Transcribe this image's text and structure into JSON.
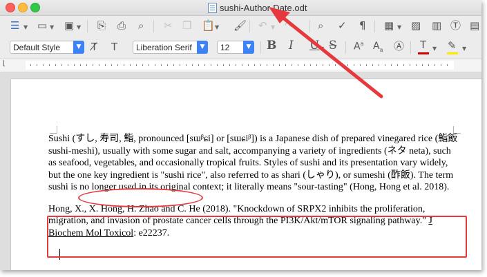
{
  "window": {
    "title": "sushi-Author-Date.odt"
  },
  "toolbar": {
    "paragraph_style": "Default Style",
    "font_name": "Liberation Serif",
    "font_size": "12",
    "bold_label": "B",
    "italic_label": "I",
    "underline_label": "U",
    "strike_label": "S",
    "font_color": "#cc0000",
    "highlight_color": "#ffe600",
    "icons": [
      "sidebar-icon",
      "open-folder-icon",
      "save-icon",
      "export-pdf-icon",
      "print-icon",
      "print-preview-icon",
      "cut-icon",
      "copy-icon",
      "paste-icon",
      "clone-formatting-icon",
      "undo-icon",
      "redo-icon",
      "find-replace-icon",
      "spelling-icon",
      "formatting-marks-icon",
      "insert-table-icon",
      "insert-image-icon",
      "insert-chart-icon",
      "insert-textbox-icon",
      "clear-formatting-icon",
      "style-update-icon",
      "superscript-icon",
      "subscript-icon"
    ]
  },
  "document": {
    "paragraph1": "Sushi (すし, 寿司, 鮨, pronounced [sɯᵝɕi] or [sɯɕiᵝ]) is a Japanese dish of prepared vinegared rice (鮨飯 sushi-meshi), usually with some sugar and salt, accompanying a variety of ingredients (ネタ neta), such as seafood, vegetables, and occasionally tropical fruits. Styles of sushi and its presentation vary widely, but the one key ingredient is \"sushi rice\", also referred to as shari (しゃり), or sumeshi (酢飯). The term sushi is no longer used in its original context; it literally means \"sour-tasting\"",
    "citation": " (Hong, Hong et al. 2018).",
    "reference_main": "Hong, X., X. Hong, H. Zhao and C. He (2018). \"Knockdown of SRPX2 inhibits the proliferation, migration, and invasion of prostate cancer cells through the PI3K/Akt/mTOR signaling pathway.\" ",
    "reference_journal": "J Biochem Mol Toxicol",
    "reference_tail": ": e22237."
  },
  "annotations": {
    "color": "#e5393e"
  }
}
